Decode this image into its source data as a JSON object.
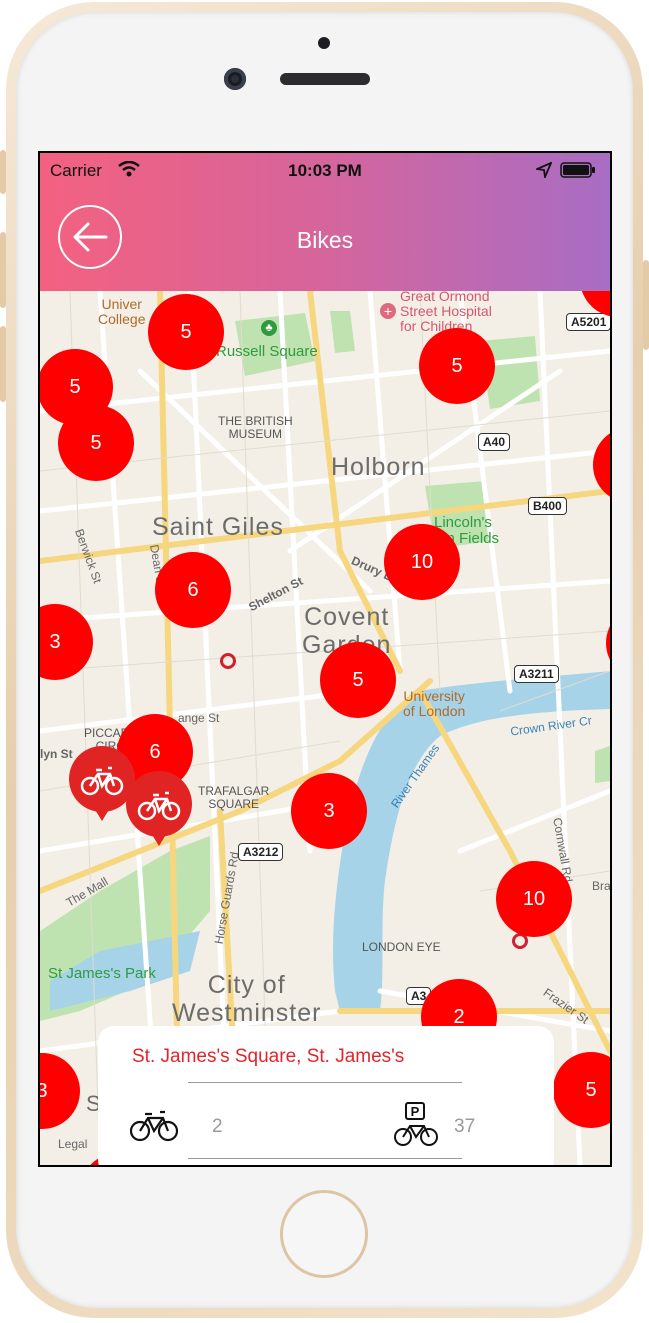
{
  "status_bar": {
    "carrier": "Carrier",
    "time": "10:03 PM"
  },
  "header": {
    "title": "Bikes"
  },
  "map_labels": {
    "university_college": "Univer\nCollege",
    "russell_square": "Russell Square",
    "great_ormond": "Great Ormond\nStreet Hospital\nfor Children",
    "british_museum": "THE BRITISH\nMUSEUM",
    "holborn": "Holborn",
    "saint_giles": "Saint Giles",
    "lincolns": "Lincoln's\nInn Fields",
    "shelton_st": "Shelton St",
    "drury_ln": "Drury Ln",
    "dean_st": "Dean St",
    "berwick_st": "Berwick St",
    "covent_garden": "Covent\nGarden",
    "university_london": "University\nof London",
    "crown_river": "Crown River Cr",
    "piccadilly": "PICCADILLY\nCIRCUS",
    "lyn_st": "lyn St",
    "orange_st": "ange St",
    "trafalgar": "TRAFALGAR\nSQUARE",
    "river_thames": "River Thames",
    "cornwall_rd": "Cornwall Rd",
    "the_mall": "The Mall",
    "horse_guards": "Horse Guards Rd",
    "london_eye": "LONDON EYE",
    "st_james_park": "St James's Park",
    "city_of_westminster": "City of\nWestminster",
    "frazier_st": "Frazier St",
    "legal": "Legal",
    "bra": "Bra",
    "st_fragment": "St"
  },
  "road_badges": {
    "a5201": "A5201",
    "a40": "A40",
    "b400": "B400",
    "a3211": "A3211",
    "a3212": "A3212",
    "a3_partial": "A3"
  },
  "clusters": [
    "5",
    "5",
    "5",
    "5",
    "10",
    "6",
    "3",
    "5",
    "6",
    "3",
    "10",
    "2",
    "3",
    "5"
  ],
  "info_card": {
    "station_name": "St. James's Square, St. James's",
    "bikes_available": "2",
    "docks_available": "37"
  },
  "colors": {
    "accent": "#ff0000",
    "header_start": "#f4617f",
    "header_end": "#a86dc4",
    "card_title": "#e0262b"
  }
}
